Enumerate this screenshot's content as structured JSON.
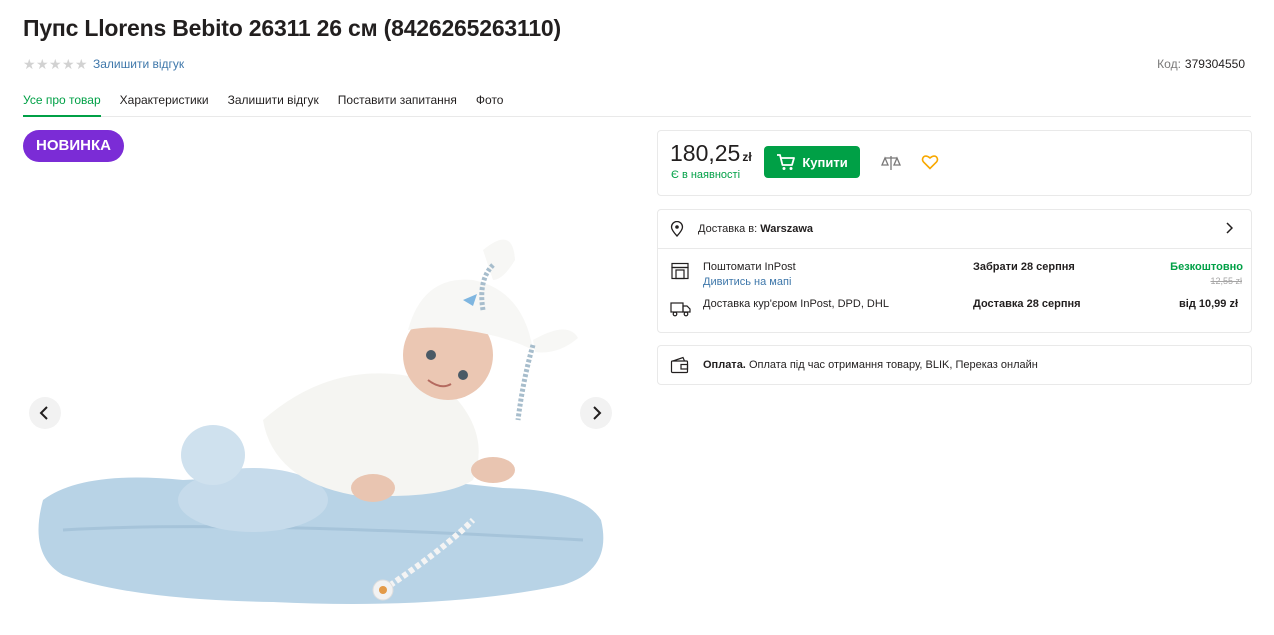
{
  "product": {
    "title": "Пупс Llorens Bebito 26311 26 см (8426265263110)",
    "review_link": "Залишити відгук",
    "code_label": "Код:",
    "code_value": "379304550"
  },
  "tabs": [
    {
      "label": "Усе про товар",
      "active": true
    },
    {
      "label": "Характеристики"
    },
    {
      "label": "Залишити відгук"
    },
    {
      "label": "Поставити запитання"
    },
    {
      "label": "Фото"
    }
  ],
  "badge": "НОВИНКА",
  "buy": {
    "price": "180,25",
    "currency": "zł",
    "availability": "Є в наявності",
    "buy_label": "Купити"
  },
  "delivery": {
    "prefix": "Доставка в:",
    "city": "Warszawa",
    "options": [
      {
        "name": "Поштомати InPost",
        "map_link": "Дивитись на мапі",
        "when": "Забрати 28 серпня",
        "price": "Безкоштовно",
        "old_price": "12,55 zł"
      },
      {
        "name": "Доставка кур'єром InPost, DPD, DHL",
        "when": "Доставка 28 серпня",
        "price": "від 10,99 zł"
      }
    ]
  },
  "payment": {
    "label": "Оплата.",
    "text": "Оплата під час отримання товару, BLIK, Переказ онлайн"
  },
  "colors": {
    "accent": "#00a046",
    "badge": "#7b2cd6",
    "link": "#3e77aa",
    "heart": "#f8a800"
  }
}
